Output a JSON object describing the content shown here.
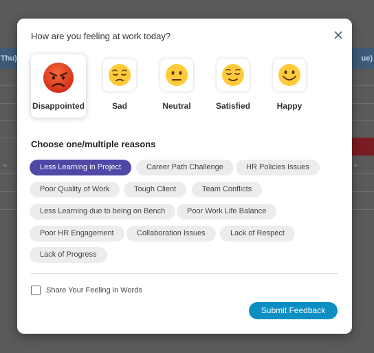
{
  "background": {
    "header_left": "Thu)",
    "header_right": "ue)"
  },
  "modal": {
    "title": "How are you feeling at work today?",
    "close_icon": "close-icon",
    "moods": [
      {
        "label": "Disappointed",
        "icon": "angry-face-icon",
        "selected": true
      },
      {
        "label": "Sad",
        "icon": "pensive-face-icon",
        "selected": false
      },
      {
        "label": "Neutral",
        "icon": "neutral-face-icon",
        "selected": false
      },
      {
        "label": "Satisfied",
        "icon": "relieved-face-icon",
        "selected": false
      },
      {
        "label": "Happy",
        "icon": "smiling-face-icon",
        "selected": false
      }
    ],
    "reasons_title": "Choose one/multiple reasons",
    "reasons": [
      {
        "label": "Less Learning in Project",
        "selected": true
      },
      {
        "label": "Career Path Challenge",
        "selected": false
      },
      {
        "label": "HR Policies Issues",
        "selected": false
      },
      {
        "label": "Poor Quality of Work",
        "selected": false
      },
      {
        "label": "Tough Client",
        "selected": false
      },
      {
        "label": "Team Conflicts",
        "selected": false
      },
      {
        "label": "Less Learning due to being on Bench",
        "selected": false
      },
      {
        "label": "Poor Work Life Balance",
        "selected": false
      },
      {
        "label": "Poor HR Engagement",
        "selected": false
      },
      {
        "label": "Collaboration Issues",
        "selected": false
      },
      {
        "label": "Lack of Respect",
        "selected": false
      },
      {
        "label": "Lack of Progress",
        "selected": false
      }
    ],
    "share_label": "Share Your Feeling in Words",
    "share_checked": false,
    "submit_label": "Submit Feedback"
  },
  "colors": {
    "selected_chip": "#4f48a6",
    "submit_button": "#0d8fc3",
    "overlay": "#5a5a5a"
  }
}
